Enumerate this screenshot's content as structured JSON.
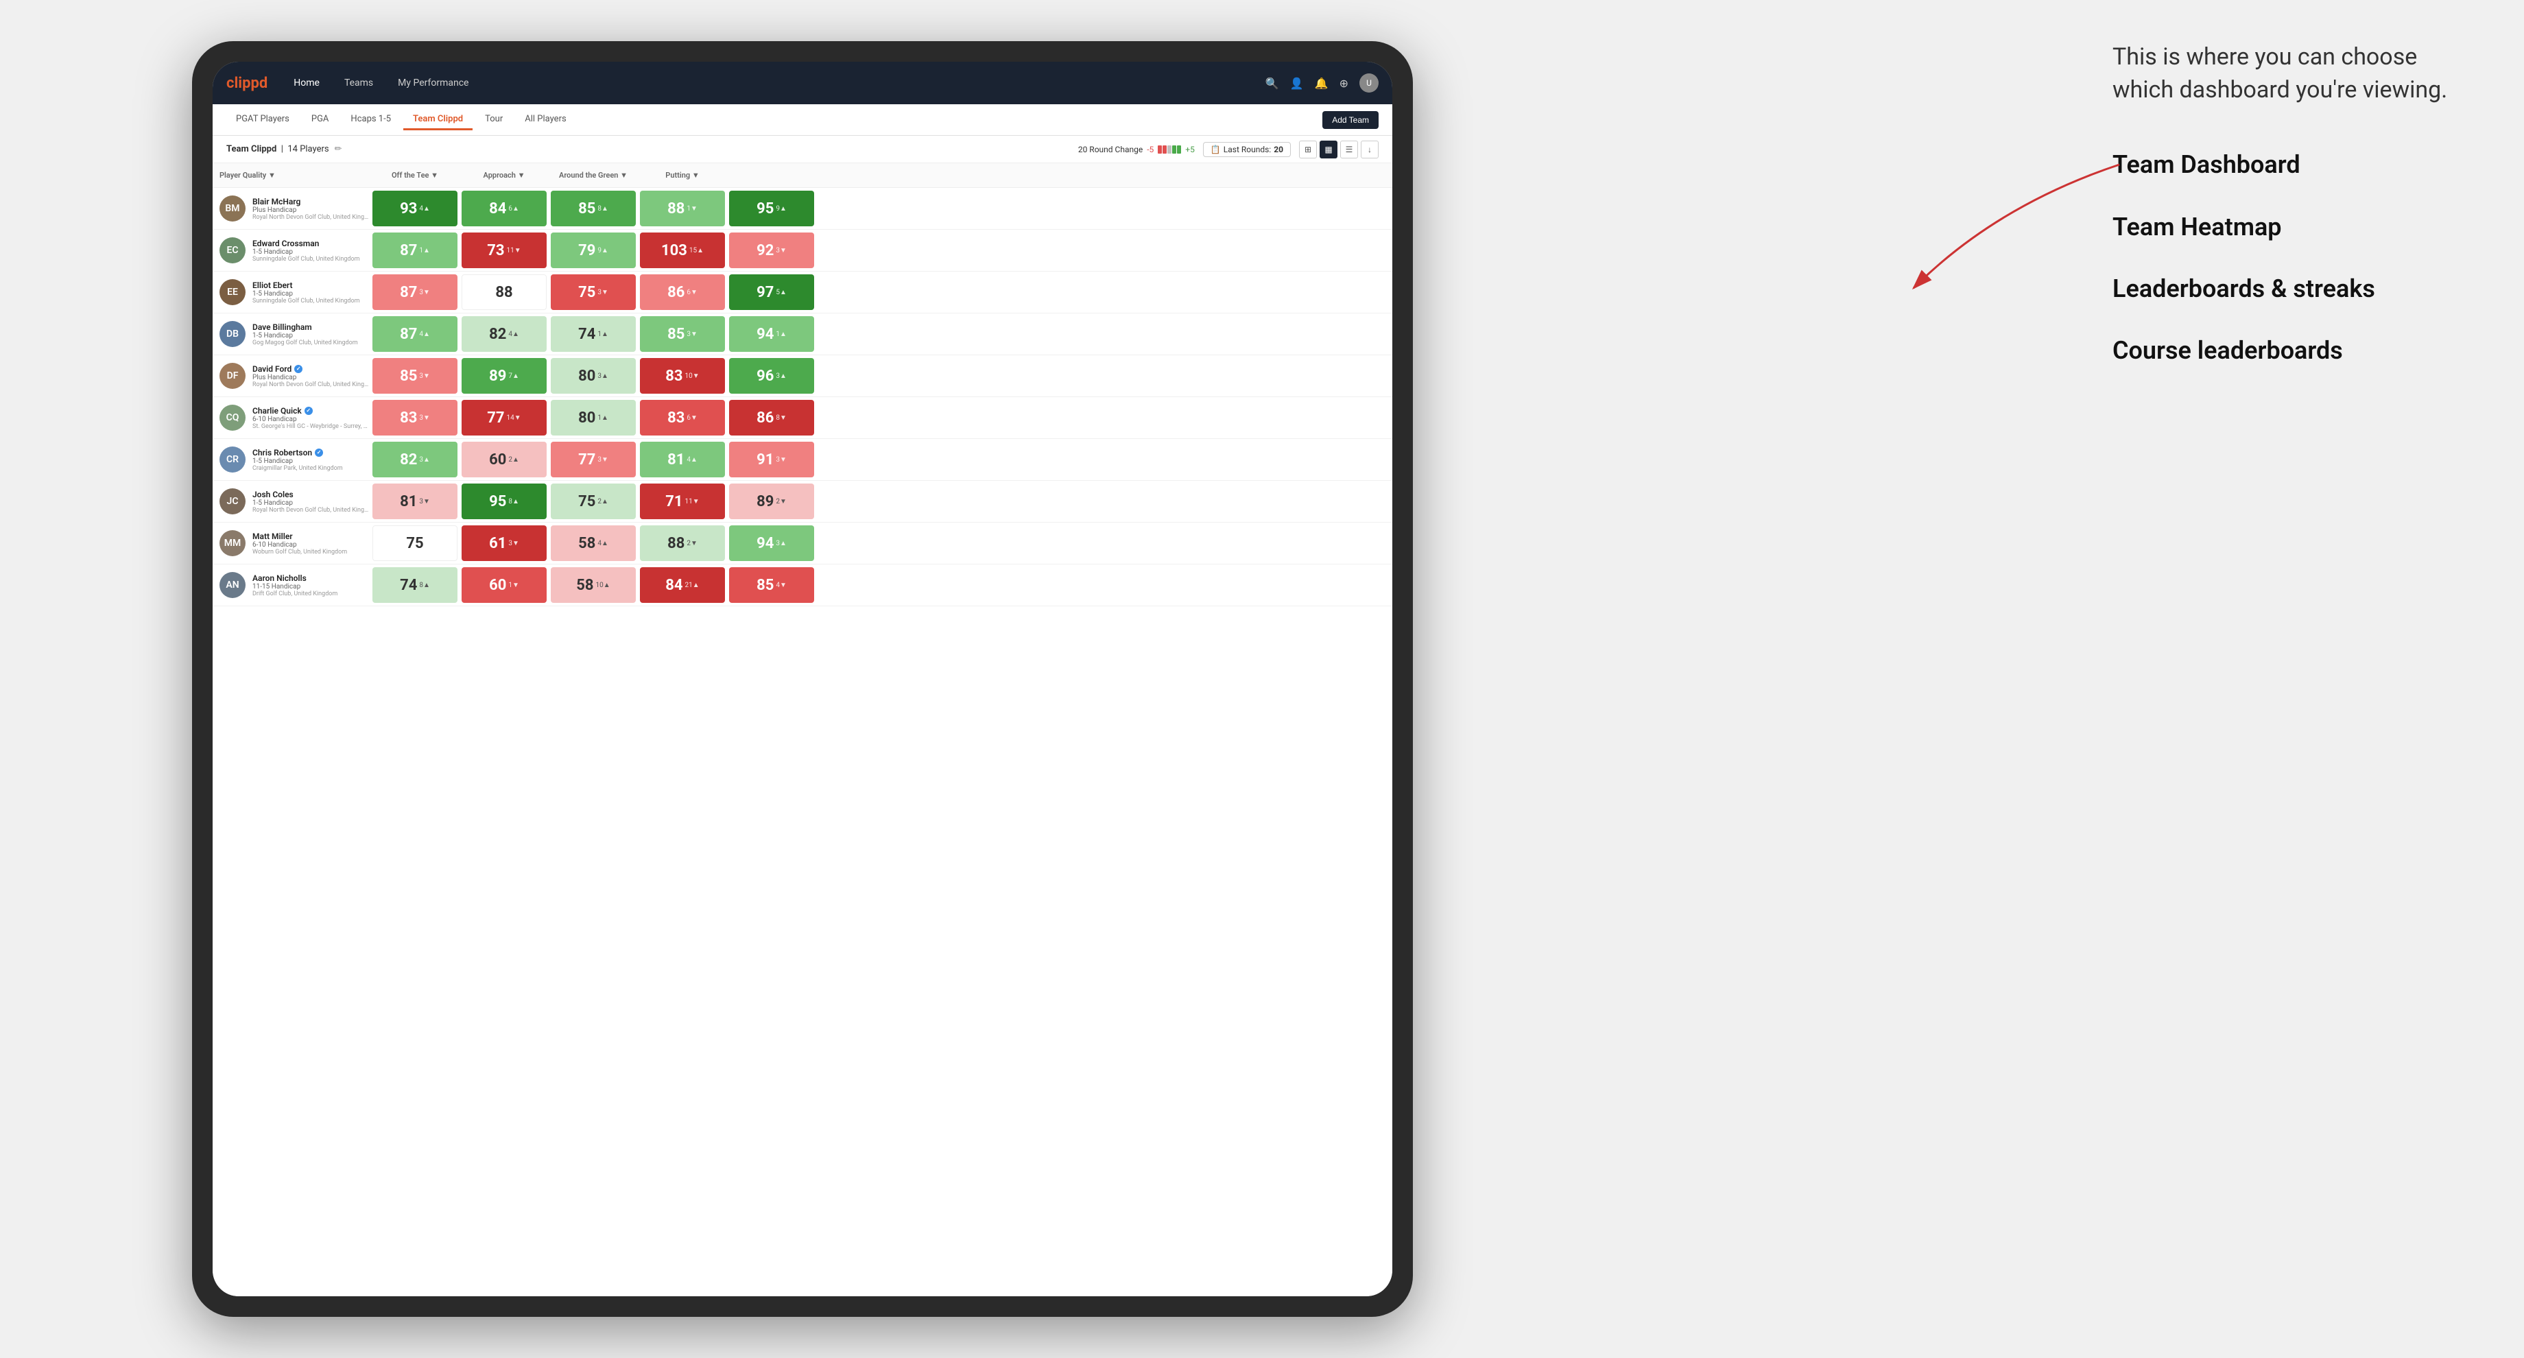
{
  "annotation": {
    "intro": "This is where you can choose which dashboard you're viewing.",
    "items": [
      "Team Dashboard",
      "Team Heatmap",
      "Leaderboards & streaks",
      "Course leaderboards"
    ]
  },
  "nav": {
    "logo": "clippd",
    "items": [
      "Home",
      "Teams",
      "My Performance"
    ],
    "icons": [
      "🔍",
      "👤",
      "🔔",
      "⊕",
      "👤"
    ]
  },
  "tabs": {
    "items": [
      "PGAT Players",
      "PGA",
      "Hcaps 1-5",
      "Team Clippd",
      "Tour",
      "All Players"
    ],
    "active": "Team Clippd",
    "add_button": "Add Team"
  },
  "subheader": {
    "team_name": "Team Clippd",
    "player_count": "14 Players",
    "round_change_label": "20 Round Change",
    "round_change_neg": "-5",
    "round_change_pos": "+5",
    "last_rounds_label": "Last Rounds:",
    "last_rounds_value": "20"
  },
  "table": {
    "columns": [
      "Player Quality ▼",
      "Off the Tee ▼",
      "Approach ▼",
      "Around the Green ▼",
      "Putting ▼"
    ],
    "players": [
      {
        "name": "Blair McHarg",
        "handicap": "Plus Handicap",
        "club": "Royal North Devon Golf Club, United Kingdom",
        "avatar_color": "#8B7355",
        "initials": "BM",
        "verified": false,
        "scores": [
          {
            "value": 93,
            "delta": "4▲",
            "bg": "green-dark"
          },
          {
            "value": 84,
            "delta": "6▲",
            "bg": "green-mid"
          },
          {
            "value": 85,
            "delta": "8▲",
            "bg": "green-mid"
          },
          {
            "value": 88,
            "delta": "1▼",
            "bg": "green-light"
          },
          {
            "value": 95,
            "delta": "9▲",
            "bg": "green-dark"
          }
        ]
      },
      {
        "name": "Edward Crossman",
        "handicap": "1-5 Handicap",
        "club": "Sunningdale Golf Club, United Kingdom",
        "avatar_color": "#6B8E6B",
        "initials": "EC",
        "verified": false,
        "scores": [
          {
            "value": 87,
            "delta": "1▲",
            "bg": "green-light"
          },
          {
            "value": 73,
            "delta": "11▼",
            "bg": "red-dark"
          },
          {
            "value": 79,
            "delta": "9▲",
            "bg": "green-light"
          },
          {
            "value": 103,
            "delta": "15▲",
            "bg": "red-dark"
          },
          {
            "value": 92,
            "delta": "3▼",
            "bg": "red-light"
          }
        ]
      },
      {
        "name": "Elliot Ebert",
        "handicap": "1-5 Handicap",
        "club": "Sunningdale Golf Club, United Kingdom",
        "avatar_color": "#7B5E42",
        "initials": "EE",
        "verified": false,
        "scores": [
          {
            "value": 87,
            "delta": "3▼",
            "bg": "red-light"
          },
          {
            "value": 88,
            "delta": "",
            "bg": "white"
          },
          {
            "value": 75,
            "delta": "3▼",
            "bg": "red-mid"
          },
          {
            "value": 86,
            "delta": "6▼",
            "bg": "red-light"
          },
          {
            "value": 97,
            "delta": "5▲",
            "bg": "green-dark"
          }
        ]
      },
      {
        "name": "Dave Billingham",
        "handicap": "1-5 Handicap",
        "club": "Gog Magog Golf Club, United Kingdom",
        "avatar_color": "#5B7A9E",
        "initials": "DB",
        "verified": false,
        "scores": [
          {
            "value": 87,
            "delta": "4▲",
            "bg": "green-light"
          },
          {
            "value": 82,
            "delta": "4▲",
            "bg": "green-pale"
          },
          {
            "value": 74,
            "delta": "1▲",
            "bg": "green-pale"
          },
          {
            "value": 85,
            "delta": "3▼",
            "bg": "green-light"
          },
          {
            "value": 94,
            "delta": "1▲",
            "bg": "green-light"
          }
        ]
      },
      {
        "name": "David Ford",
        "handicap": "Plus Handicap",
        "club": "Royal North Devon Golf Club, United Kingdom",
        "avatar_color": "#9E7A5B",
        "initials": "DF",
        "verified": true,
        "scores": [
          {
            "value": 85,
            "delta": "3▼",
            "bg": "red-light"
          },
          {
            "value": 89,
            "delta": "7▲",
            "bg": "green-mid"
          },
          {
            "value": 80,
            "delta": "3▲",
            "bg": "green-pale"
          },
          {
            "value": 83,
            "delta": "10▼",
            "bg": "red-dark"
          },
          {
            "value": 96,
            "delta": "3▲",
            "bg": "green-mid"
          }
        ]
      },
      {
        "name": "Charlie Quick",
        "handicap": "6-10 Handicap",
        "club": "St. George's Hill GC - Weybridge - Surrey, Uni...",
        "avatar_color": "#7E9E7A",
        "initials": "CQ",
        "verified": true,
        "scores": [
          {
            "value": 83,
            "delta": "3▼",
            "bg": "red-light"
          },
          {
            "value": 77,
            "delta": "14▼",
            "bg": "red-dark"
          },
          {
            "value": 80,
            "delta": "1▲",
            "bg": "green-pale"
          },
          {
            "value": 83,
            "delta": "6▼",
            "bg": "red-mid"
          },
          {
            "value": 86,
            "delta": "8▼",
            "bg": "red-dark"
          }
        ]
      },
      {
        "name": "Chris Robertson",
        "handicap": "1-5 Handicap",
        "club": "Craigmillar Park, United Kingdom",
        "avatar_color": "#6A8BB0",
        "initials": "CR",
        "verified": true,
        "scores": [
          {
            "value": 82,
            "delta": "3▲",
            "bg": "green-light"
          },
          {
            "value": 60,
            "delta": "2▲",
            "bg": "red-pale"
          },
          {
            "value": 77,
            "delta": "3▼",
            "bg": "red-light"
          },
          {
            "value": 81,
            "delta": "4▲",
            "bg": "green-light"
          },
          {
            "value": 91,
            "delta": "3▼",
            "bg": "red-light"
          }
        ]
      },
      {
        "name": "Josh Coles",
        "handicap": "1-5 Handicap",
        "club": "Royal North Devon Golf Club, United Kingdom",
        "avatar_color": "#7B6A5A",
        "initials": "JC",
        "verified": false,
        "scores": [
          {
            "value": 81,
            "delta": "3▼",
            "bg": "red-pale"
          },
          {
            "value": 95,
            "delta": "8▲",
            "bg": "green-dark"
          },
          {
            "value": 75,
            "delta": "2▲",
            "bg": "green-pale"
          },
          {
            "value": 71,
            "delta": "11▼",
            "bg": "red-dark"
          },
          {
            "value": 89,
            "delta": "2▼",
            "bg": "red-pale"
          }
        ]
      },
      {
        "name": "Matt Miller",
        "handicap": "6-10 Handicap",
        "club": "Woburn Golf Club, United Kingdom",
        "avatar_color": "#8A7A6A",
        "initials": "MM",
        "verified": false,
        "scores": [
          {
            "value": 75,
            "delta": "",
            "bg": "white"
          },
          {
            "value": 61,
            "delta": "3▼",
            "bg": "red-dark"
          },
          {
            "value": 58,
            "delta": "4▲",
            "bg": "red-pale"
          },
          {
            "value": 88,
            "delta": "2▼",
            "bg": "green-pale"
          },
          {
            "value": 94,
            "delta": "3▲",
            "bg": "green-light"
          }
        ]
      },
      {
        "name": "Aaron Nicholls",
        "handicap": "11-15 Handicap",
        "club": "Drift Golf Club, United Kingdom",
        "avatar_color": "#6A7A8A",
        "initials": "AN",
        "verified": false,
        "scores": [
          {
            "value": 74,
            "delta": "8▲",
            "bg": "green-pale"
          },
          {
            "value": 60,
            "delta": "1▼",
            "bg": "red-mid"
          },
          {
            "value": 58,
            "delta": "10▲",
            "bg": "red-pale"
          },
          {
            "value": 84,
            "delta": "21▲",
            "bg": "red-dark"
          },
          {
            "value": 85,
            "delta": "4▼",
            "bg": "red-mid"
          }
        ]
      }
    ]
  }
}
